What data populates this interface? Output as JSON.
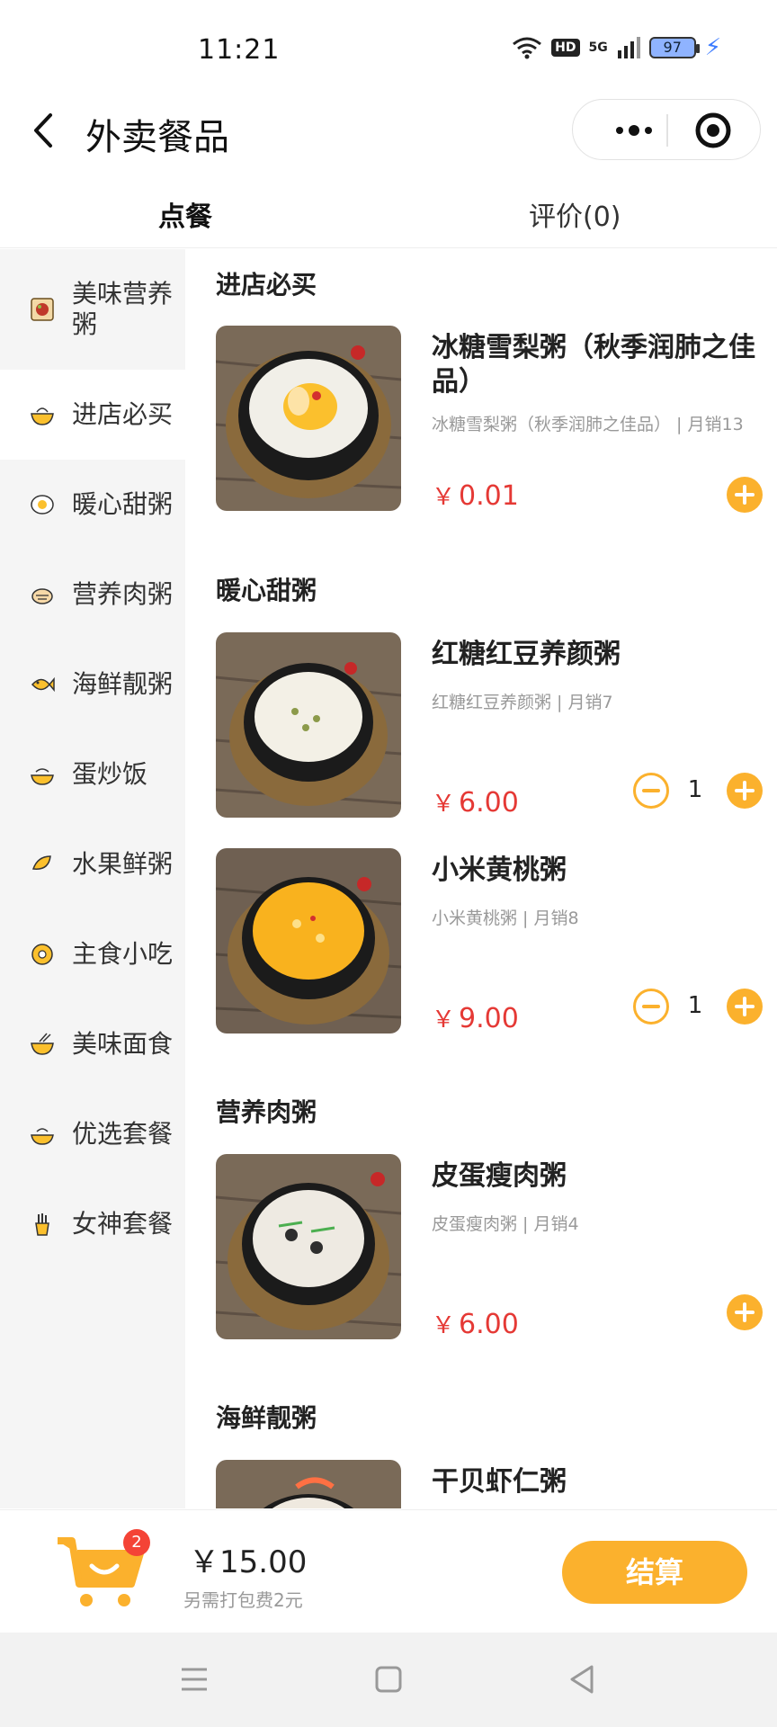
{
  "status_bar": {
    "time": "11:21",
    "hd": "HD",
    "network": "5G",
    "battery": "97"
  },
  "header": {
    "title": "外卖餐品"
  },
  "tabs": [
    {
      "label": "点餐"
    },
    {
      "label": "评价(0)"
    }
  ],
  "sidebar": {
    "items": [
      {
        "label": "美味营养粥",
        "icon": "porridge-icon"
      },
      {
        "label": "进店必买",
        "icon": "bowl-icon"
      },
      {
        "label": "暖心甜粥",
        "icon": "egg-icon"
      },
      {
        "label": "营养肉粥",
        "icon": "meat-icon"
      },
      {
        "label": "海鲜靓粥",
        "icon": "fish-icon"
      },
      {
        "label": "蛋炒饭",
        "icon": "rice-icon"
      },
      {
        "label": "水果鲜粥",
        "icon": "fruit-icon"
      },
      {
        "label": "主食小吃",
        "icon": "snack-icon"
      },
      {
        "label": "美味面食",
        "icon": "noodle-icon"
      },
      {
        "label": "优选套餐",
        "icon": "set-meal-icon"
      },
      {
        "label": "女神套餐",
        "icon": "fries-icon"
      }
    ]
  },
  "menu": {
    "sections": [
      {
        "title": "进店必买",
        "dishes": [
          {
            "name": "冰糖雪梨粥（秋季润肺之佳品）",
            "desc": "冰糖雪梨粥（秋季润肺之佳品） | 月销13",
            "price": "0.01",
            "currency": "￥"
          }
        ]
      },
      {
        "title": "暖心甜粥",
        "dishes": [
          {
            "name": "红糖红豆养颜粥",
            "desc": "红糖红豆养颜粥 | 月销7",
            "price": "6.00",
            "currency": "￥",
            "qty": "1"
          },
          {
            "name": "小米黄桃粥",
            "desc": "小米黄桃粥 | 月销8",
            "price": "9.00",
            "currency": "￥",
            "qty": "1"
          }
        ]
      },
      {
        "title": "营养肉粥",
        "dishes": [
          {
            "name": "皮蛋瘦肉粥",
            "desc": "皮蛋瘦肉粥 | 月销4",
            "price": "6.00",
            "currency": "￥"
          }
        ]
      },
      {
        "title": "海鲜靓粥",
        "dishes": [
          {
            "name": "干贝虾仁粥"
          }
        ]
      }
    ]
  },
  "cart": {
    "badge": "2",
    "total": "￥15.00",
    "note": "另需打包费2元",
    "checkout_label": "结算"
  },
  "colors": {
    "accent": "#fbb12d",
    "price": "#e53935",
    "badge": "#f44336"
  }
}
